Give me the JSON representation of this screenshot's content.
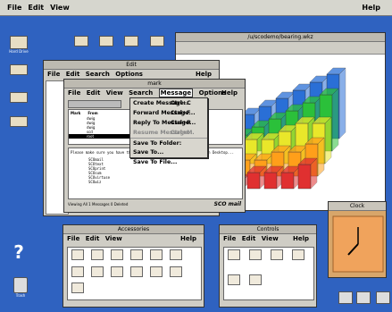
{
  "topbar": {
    "file": "File",
    "edit": "Edit",
    "view": "View",
    "help": "Help"
  },
  "desktop_icons": [
    "Hard Drive",
    "",
    "",
    "",
    "",
    "Trash"
  ],
  "chart_window": {
    "title": "/u/scodemo/bearing.wkz"
  },
  "edit_window": {
    "title": "Edit",
    "menu": [
      "File",
      "Edit",
      "Search",
      "Options"
    ],
    "help": "Help"
  },
  "mail_window": {
    "title": "mark",
    "menu": [
      "File",
      "Edit",
      "View",
      "Search",
      "Message",
      "Options"
    ],
    "help": "Help",
    "list_headers": [
      "Mark",
      "From"
    ],
    "rows": [
      "dwig",
      "dwig",
      "dwig",
      "scd",
      "root"
    ],
    "body": "Please make sure you have the OpenDesktop 2.0 release of SCO Open Desktop...",
    "files": [
      "SCOmail",
      "SCOtext",
      "SCOprint",
      "SCOsum",
      "SCOvirtuse",
      "SCOwiz"
    ],
    "status": "Viewing All  1 Messages  0 Deleted",
    "logo": "SCO mail"
  },
  "message_menu": [
    {
      "label": "Create Message...",
      "shortcut": "Ctrl+C",
      "dim": false
    },
    {
      "label": "Forward Message...",
      "shortcut": "Ctrl+F",
      "dim": false
    },
    {
      "label": "Reply To Message...",
      "shortcut": "Ctrl+R",
      "dim": false
    },
    {
      "label": "Resume Message...",
      "shortcut": "Ctrl+M",
      "dim": true
    },
    {
      "label": "Save To Folder:",
      "shortcut": "",
      "dim": false
    },
    {
      "label": "Save To...",
      "shortcut": "",
      "dim": false
    },
    {
      "label": "Save To File...",
      "shortcut": "",
      "dim": false
    }
  ],
  "accessories": {
    "title": "Accessories",
    "menu": [
      "File",
      "Edit",
      "View"
    ],
    "help": "Help",
    "icons": [
      "",
      "",
      "",
      "",
      "",
      "",
      "",
      "",
      "",
      "",
      "",
      "",
      ""
    ]
  },
  "controls": {
    "title": "Controls",
    "menu": [
      "File",
      "Edit",
      "View"
    ],
    "help": "Help",
    "icons": [
      "",
      "",
      "",
      "",
      "",
      ""
    ]
  },
  "clock": {
    "title": "Clock"
  },
  "chart_data": {
    "type": "bar",
    "series": [
      {
        "values": [
          3,
          4,
          5,
          6,
          7,
          8
        ]
      },
      {
        "values": [
          2,
          3,
          4,
          5,
          6,
          7
        ]
      },
      {
        "values": [
          2,
          3,
          3,
          4,
          5,
          5
        ]
      },
      {
        "values": [
          1,
          2,
          2,
          3,
          3,
          4
        ]
      },
      {
        "values": [
          1,
          1,
          2,
          2,
          2,
          3
        ]
      }
    ]
  }
}
